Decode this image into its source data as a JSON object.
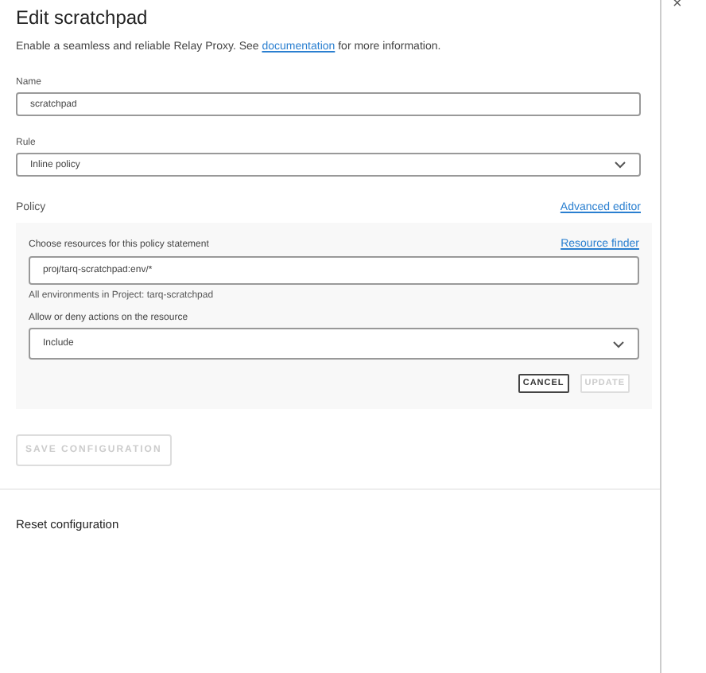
{
  "dialog": {
    "title": "Edit scratchpad",
    "close": "×",
    "description_before": "Enable a seamless and reliable Relay Proxy. See ",
    "description_link": "documentation",
    "description_after": " for more information."
  },
  "name_field": {
    "label": "Name",
    "value": "scratchpad"
  },
  "rule_field": {
    "label": "Rule",
    "value": "Inline policy"
  },
  "policy": {
    "label": "Policy",
    "link": "Advanced editor",
    "statement": {
      "resources_label": "Choose resources for this policy statement",
      "resources_link": "Resource finder",
      "resources_value": "proj/tarq-scratchpad:env/*",
      "resources_hint": "All environments in Project: tarq-scratchpad",
      "actions_label": "Allow or deny actions on the resource",
      "actions_value": "Include",
      "buttons": [
        {
          "label": "CANCEL",
          "disabled": false
        },
        {
          "label": "UPDATE",
          "disabled": true
        }
      ]
    }
  },
  "save_button": {
    "label": "SAVE CONFIGURATION",
    "disabled": true
  },
  "reset_section": {
    "title": "Reset configuration"
  }
}
